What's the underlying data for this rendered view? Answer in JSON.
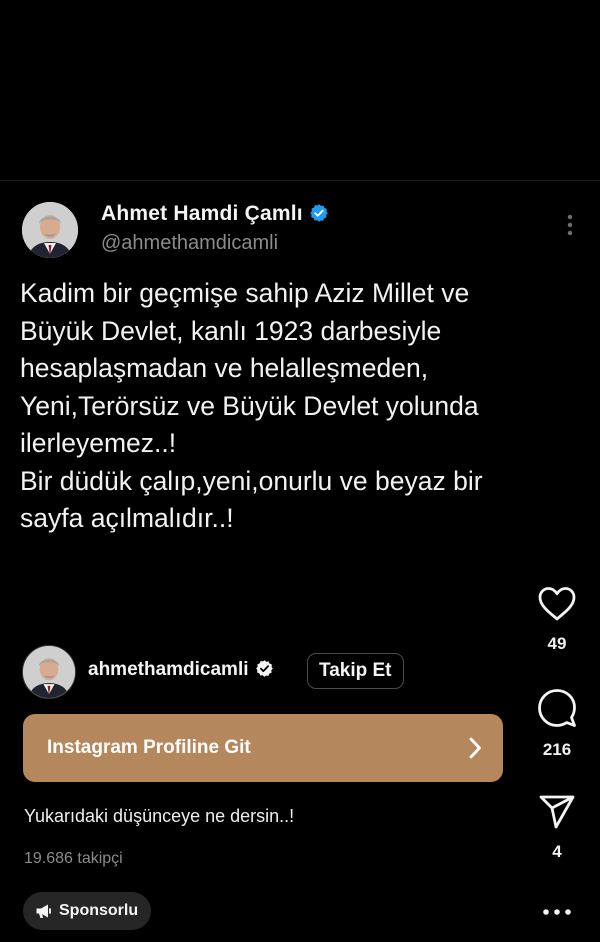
{
  "post": {
    "author_name": "Ahmet Hamdi Çamlı",
    "author_handle": "@ahmethamdicamli",
    "text": "Kadim bir geçmişe sahip Aziz Millet  ve\nBüyük Devlet, kanlı 1923 darbesiyle\nhesaplaşmadan ve helalleşmeden,\nYeni,Terörsüz ve Büyük Devlet yolunda\nilerleyemez..!\nBir düdük çalıp,yeni,onurlu ve beyaz bir\nsayfa açılmalıdır..!"
  },
  "actions": {
    "likes": "49",
    "comments": "216",
    "shares": "4"
  },
  "profile": {
    "username": "ahmethamdicamli",
    "follow_label": "Takip Et",
    "cta_label": "Instagram Profiline Git",
    "caption": "Yukarıdaki düşünceye ne dersin..!",
    "followers": "19.686 takipçi",
    "sponsored_label": "Sponsorlu"
  },
  "icons": {
    "verified": "verified-badge-icon",
    "like": "heart-icon",
    "comment": "comment-icon",
    "share": "send-icon",
    "more": "more-icon",
    "chevron": "chevron-right-icon",
    "sponsored": "megaphone-icon"
  },
  "colors": {
    "background": "#000000",
    "cta_background": "#b4875d",
    "verified_blue": "#1d9bf0",
    "secondary_text": "#8b8b8b"
  }
}
